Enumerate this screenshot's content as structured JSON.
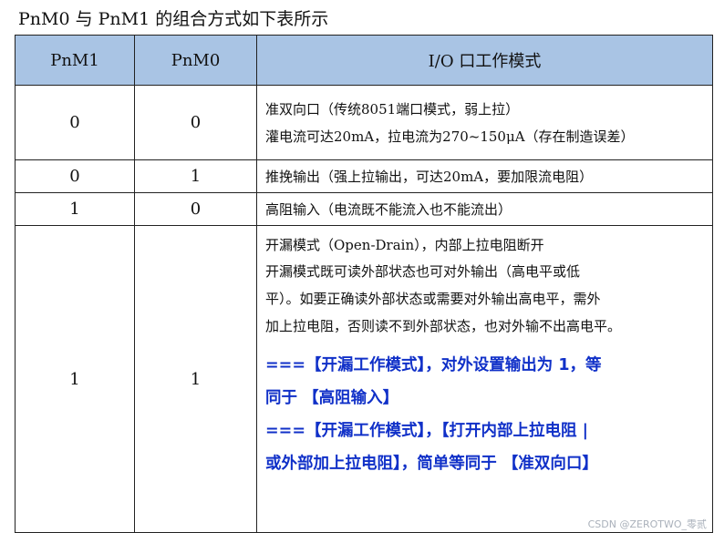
{
  "caption": "PnM0 与 PnM1 的组合方式如下表所示",
  "headers": {
    "pnm1": "PnM1",
    "pnm0": "PnM0",
    "mode": "I/O 口工作模式"
  },
  "rows": [
    {
      "pnm1": "0",
      "pnm0": "0",
      "lines": [
        "准双向口（传统8051端口模式，弱上拉）",
        "灌电流可达20mA，拉电流为270~150μA（存在制造误差）"
      ]
    },
    {
      "pnm1": "0",
      "pnm0": "1",
      "lines": [
        "推挽输出（强上拉输出，可达20mA，要加限流电阻）"
      ]
    },
    {
      "pnm1": "1",
      "pnm0": "0",
      "lines": [
        "高阻输入（电流既不能流入也不能流出）"
      ]
    },
    {
      "pnm1": "1",
      "pnm0": "1",
      "lines": [
        "开漏模式（Open-Drain），内部上拉电阻断开",
        "开漏模式既可读外部状态也可对外输出（高电平或低",
        "平）。如要正确读外部状态或需要对外输出高电平，需外",
        "加上拉电阻，否则读不到外部状态，也对外输不出高电平。"
      ],
      "notes": [
        "===【开漏工作模式】，对外设置输出为 1，等",
        "同于 【高阻输入】",
        "===【开漏工作模式】，【打开内部上拉电阻 |",
        "或外部加上拉电阻】，简单等同于 【准双向口】"
      ]
    }
  ],
  "watermark": "CSDN @ZEROTWO_零贰"
}
